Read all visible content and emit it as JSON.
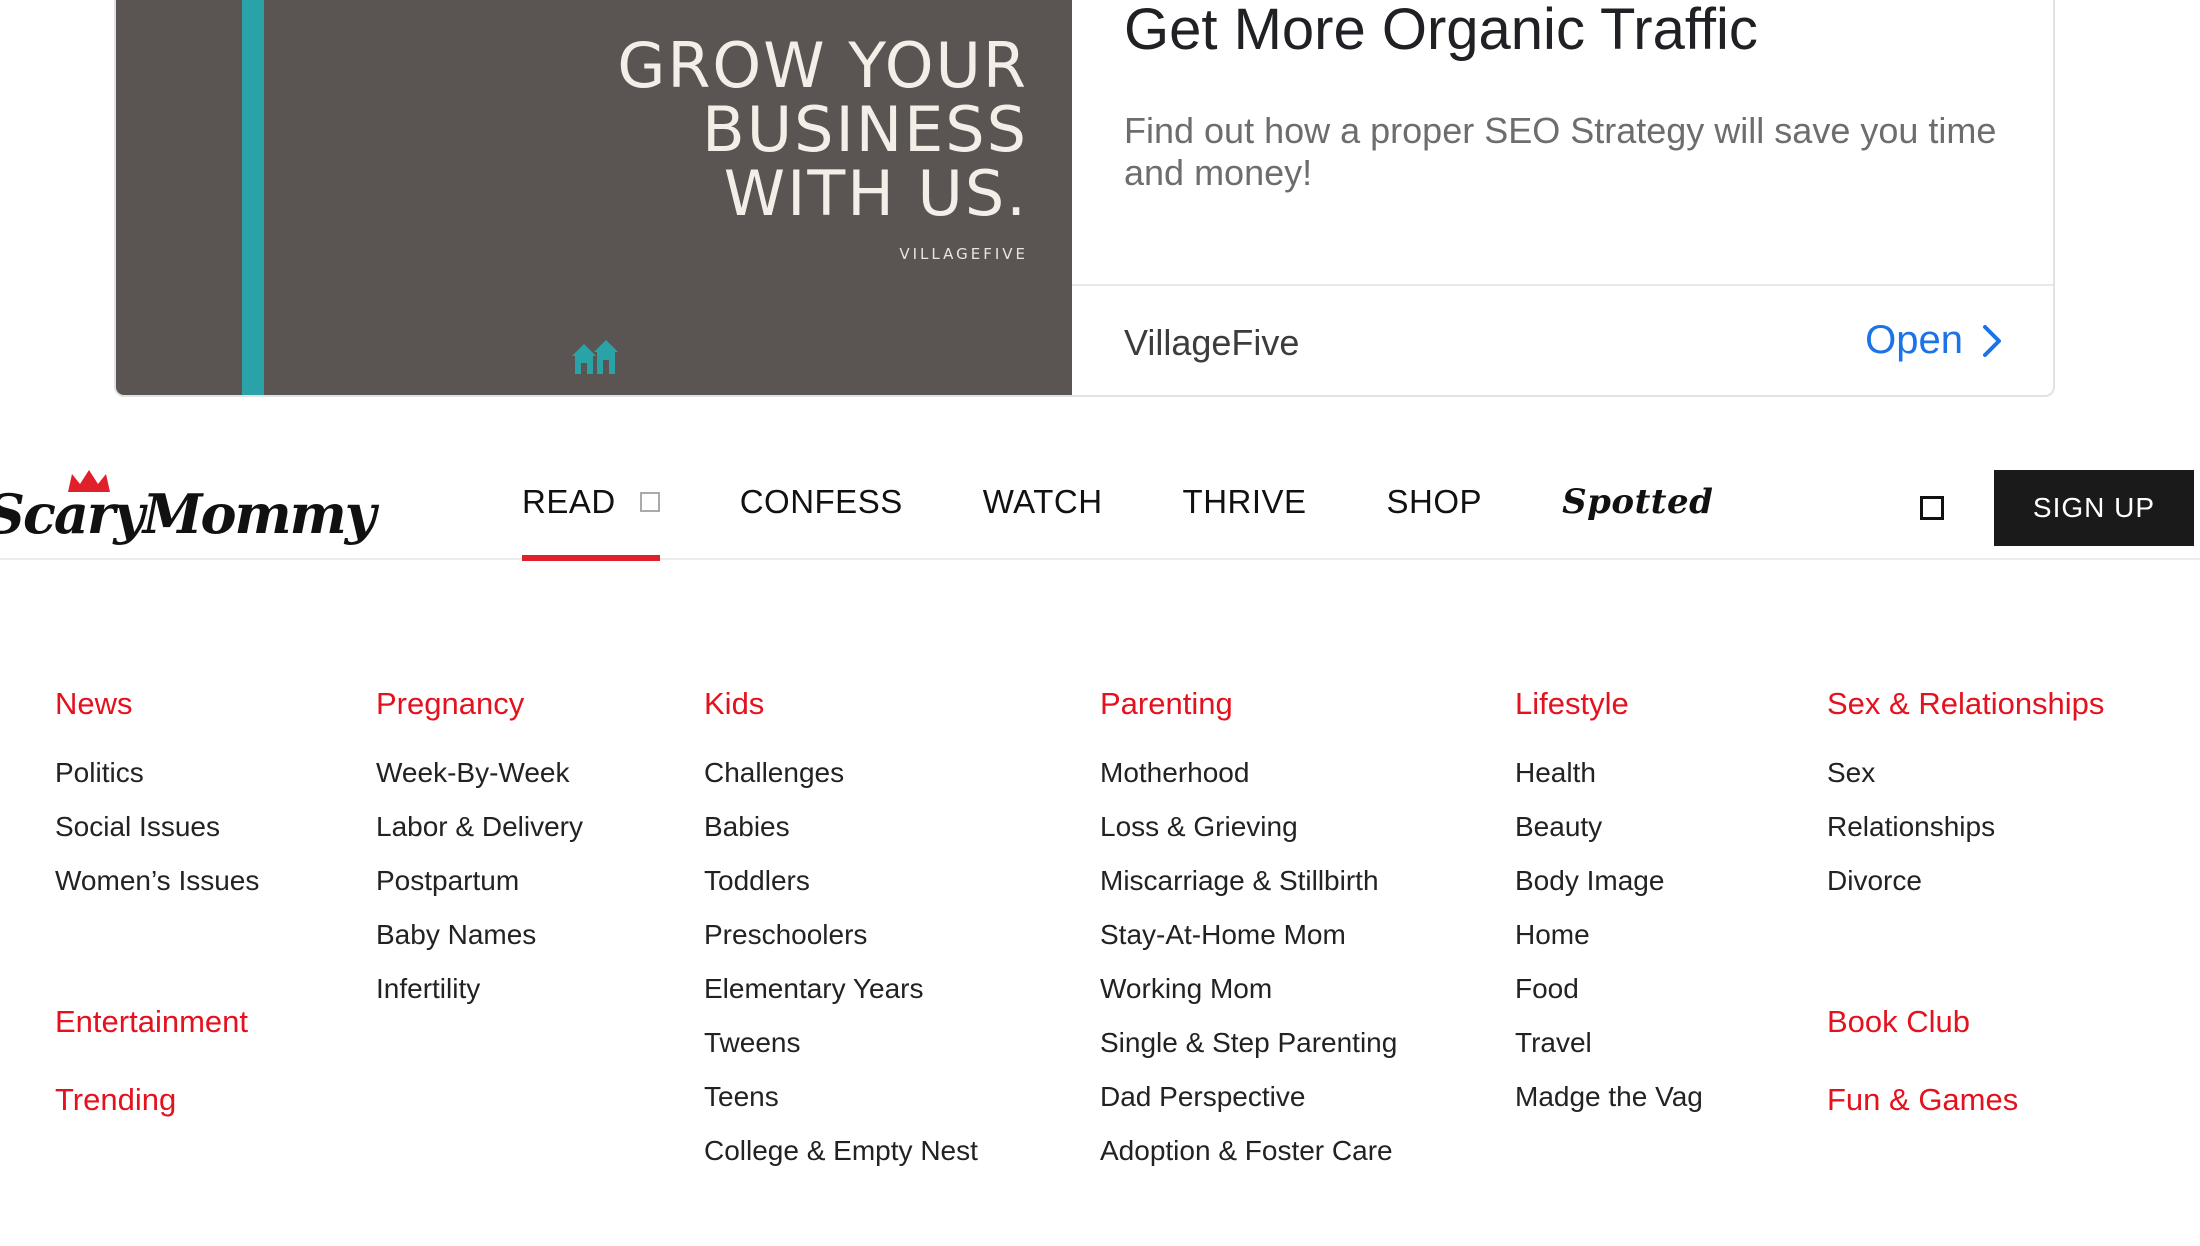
{
  "ad": {
    "headline_lines": [
      "GROW YOUR",
      "BUSINESS",
      "WITH US."
    ],
    "image_brand": "VILLAGEFIVE",
    "title": "Get More Organic Traffic",
    "description": "Find out how a proper SEO Strategy will save you time and money!",
    "advertiser": "VillageFive",
    "cta_label": "Open",
    "cta_icon": "chevron-right-icon",
    "colors": {
      "image_bg": "#5a5552",
      "stripe": "#2aa3a8",
      "cta": "#1a73e8"
    }
  },
  "nav": {
    "logo_text": "ScaryMommy",
    "items": [
      {
        "label": "READ",
        "active": true
      },
      {
        "label": "CONFESS"
      },
      {
        "label": "WATCH"
      },
      {
        "label": "THRIVE"
      },
      {
        "label": "SHOP"
      },
      {
        "label": "Spotted"
      }
    ],
    "signup_label": "SIGN UP",
    "colors": {
      "active_underline": "#e0202a",
      "signup_bg": "#1a1a1a"
    }
  },
  "menu": {
    "accent_color": "#e4121f",
    "columns": [
      {
        "heading": "News",
        "items": [
          "Politics",
          "Social Issues",
          "Women’s Issues"
        ],
        "extra_headings": [
          "Entertainment",
          "Trending"
        ]
      },
      {
        "heading": "Pregnancy",
        "items": [
          "Week-By-Week",
          "Labor & Delivery",
          "Postpartum",
          "Baby Names",
          "Infertility"
        ]
      },
      {
        "heading": "Kids",
        "items": [
          "Challenges",
          "Babies",
          "Toddlers",
          "Preschoolers",
          "Elementary Years",
          "Tweens",
          "Teens",
          "College & Empty Nest"
        ]
      },
      {
        "heading": "Parenting",
        "items": [
          "Motherhood",
          "Loss & Grieving",
          "Miscarriage & Stillbirth",
          "Stay-At-Home Mom",
          "Working Mom",
          "Single & Step Parenting",
          "Dad Perspective",
          "Adoption & Foster Care"
        ]
      },
      {
        "heading": "Lifestyle",
        "items": [
          "Health",
          "Beauty",
          "Body Image",
          "Home",
          "Food",
          "Travel",
          "Madge the Vag"
        ]
      },
      {
        "heading": "Sex & Relationships",
        "items": [
          "Sex",
          "Relationships",
          "Divorce"
        ],
        "extra_headings": [
          "Book Club",
          "Fun & Games"
        ]
      }
    ]
  }
}
